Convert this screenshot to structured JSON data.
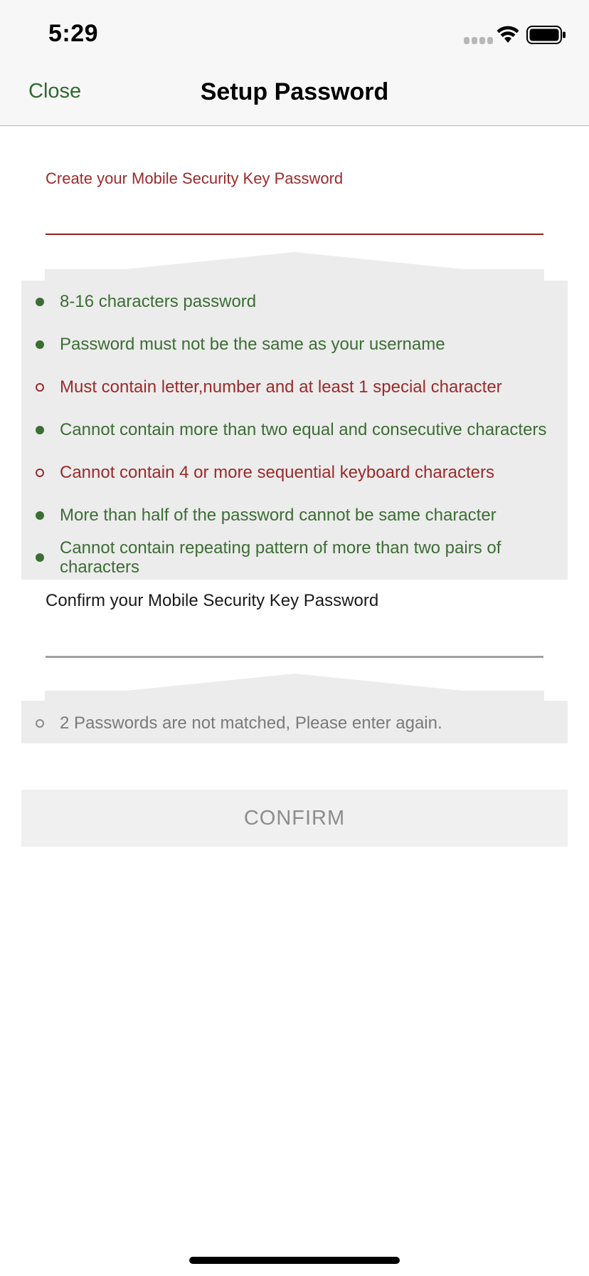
{
  "status_bar": {
    "time": "5:29",
    "icons": [
      "signal-icon",
      "wifi-icon",
      "battery-icon"
    ]
  },
  "nav": {
    "close_label": "Close",
    "title": "Setup Password"
  },
  "create_field": {
    "label": "Create your Mobile Security Key Password",
    "value": ""
  },
  "rules": [
    {
      "text": "8-16 characters password",
      "met": true
    },
    {
      "text": "Password must not be the same as your username",
      "met": true
    },
    {
      "text": "Must contain letter,number and at least 1 special character",
      "met": false
    },
    {
      "text": "Cannot contain more than two equal and consecutive characters",
      "met": true
    },
    {
      "text": "Cannot contain 4 or more sequential keyboard characters",
      "met": false
    },
    {
      "text": "More than half of the password cannot be same character",
      "met": true
    },
    {
      "text": "Cannot contain repeating pattern of more than two pairs of characters",
      "met": true
    }
  ],
  "confirm_field": {
    "label": "Confirm your Mobile Security Key Password",
    "value": ""
  },
  "match_rule": {
    "text": "2 Passwords are not matched, Please enter again.",
    "met": false
  },
  "confirm_button_label": "CONFIRM",
  "colors": {
    "met": "#3c6d34",
    "unmet": "#9b2a2a",
    "panel": "#ececec"
  }
}
